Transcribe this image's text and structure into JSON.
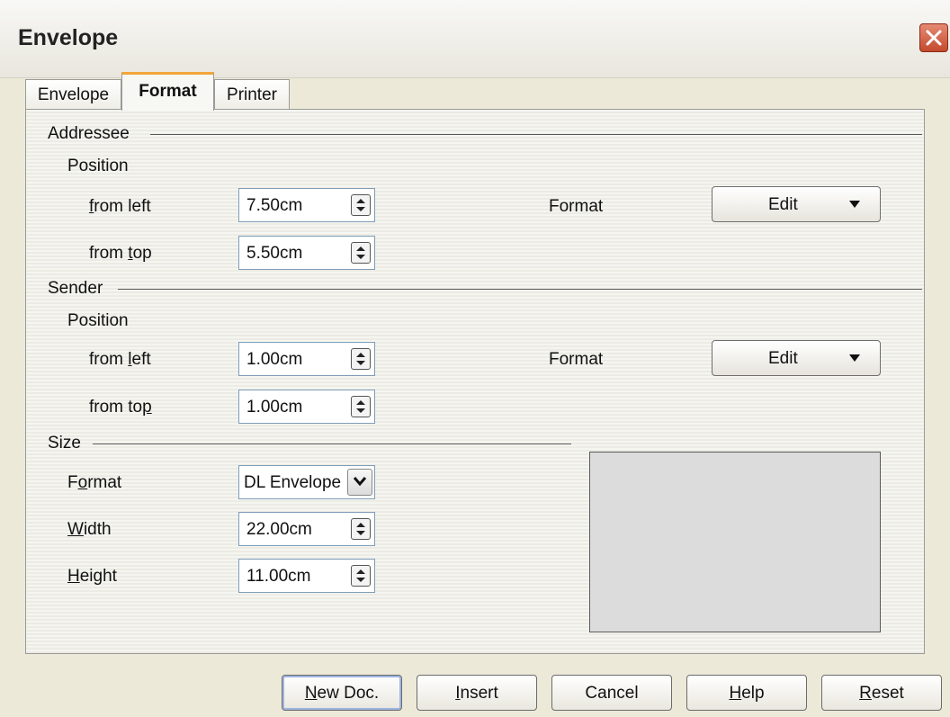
{
  "window": {
    "title": "Envelope",
    "close_icon": "close-icon"
  },
  "tabs": [
    {
      "label": "Envelope",
      "active": false
    },
    {
      "label": "Format",
      "active": true
    },
    {
      "label": "Printer",
      "active": false
    }
  ],
  "addressee": {
    "section_label": "Addressee",
    "position_label": "Position",
    "from_left_label": "from left",
    "from_left_value": "7.50cm",
    "from_top_label": "from top",
    "from_top_value": "5.50cm",
    "format_label": "Format",
    "edit_label": "Edit"
  },
  "sender": {
    "section_label": "Sender",
    "position_label": "Position",
    "from_left_label": "from left",
    "from_left_value": "1.00cm",
    "from_top_label": "from top",
    "from_top_value": "1.00cm",
    "format_label": "Format",
    "edit_label": "Edit"
  },
  "size": {
    "section_label": "Size",
    "format_label": "Format",
    "format_value": "DL Envelope",
    "width_label": "Width",
    "width_value": "22.00cm",
    "height_label": "Height",
    "height_value": "11.00cm"
  },
  "buttons": {
    "new_doc": "New Doc.",
    "insert": "Insert",
    "cancel": "Cancel",
    "help": "Help",
    "reset": "Reset"
  },
  "colors": {
    "active_tab_accent": "#f2a53a",
    "close_button": "#c44a2e"
  }
}
